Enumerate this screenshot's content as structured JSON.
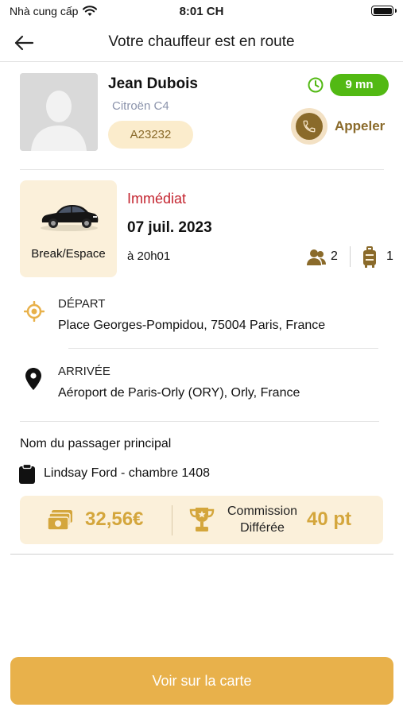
{
  "status_bar": {
    "carrier": "Nhà cung cấp",
    "time": "8:01 CH"
  },
  "nav": {
    "title": "Votre chauffeur est en route"
  },
  "driver": {
    "name": "Jean Dubois",
    "car": "Citroën C4",
    "plate": "A23232",
    "eta": "9 mn",
    "call_label": "Appeler"
  },
  "ride": {
    "vehicle_type": "Break/Espace",
    "mode": "Immédiat",
    "date": "07 juil. 2023",
    "time": "à 20h01",
    "passengers": "2",
    "luggage": "1"
  },
  "departure": {
    "label": "DÉPART",
    "address": "Place Georges-Pompidou, 75004 Paris, France"
  },
  "arrival": {
    "label": "ARRIVÉE",
    "address": "Aéroport de Paris-Orly (ORY), Orly, France"
  },
  "passenger": {
    "title": "Nom du passager principal",
    "name": "Lindsay Ford - chambre 1408"
  },
  "fare": {
    "amount": "32,56€",
    "commission_line1": "Commission",
    "commission_line2": "Différée",
    "points": "40 pt"
  },
  "map_button": {
    "label": "Voir sur la carte"
  },
  "colors": {
    "accent": "#e8b14b",
    "brown": "#8a6a2a",
    "eta_green": "#52b913",
    "mode_red": "#c4242f",
    "card_bg": "#fbf0da"
  },
  "icons": {
    "back": "arrow-left-icon",
    "clock": "clock-icon",
    "phone": "phone-icon",
    "passengers": "users-icon",
    "luggage": "luggage-icon",
    "departure": "location-target-icon",
    "arrival": "map-pin-icon",
    "passenger": "clipboard-icon",
    "fare": "cash-icon",
    "commission": "trophy-icon"
  }
}
